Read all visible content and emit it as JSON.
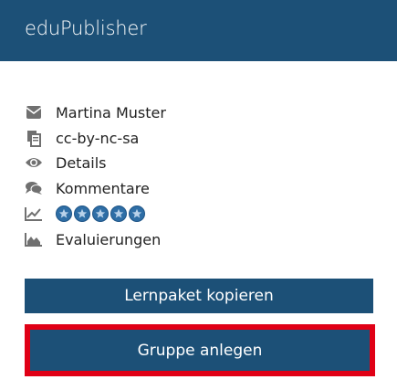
{
  "header": {
    "title": "eduPublisher"
  },
  "meta": {
    "author": "Martina Muster",
    "license": "cc-by-nc-sa",
    "details": "Details",
    "comments": "Kommentare",
    "rating": {
      "value": 5,
      "max": 5
    },
    "evaluations": "Evaluierungen"
  },
  "icons": {
    "author": "envelope-icon",
    "license": "copy-icon",
    "details": "eye-icon",
    "comments": "comments-icon",
    "rating": "line-chart-icon",
    "evaluations": "area-chart-icon"
  },
  "buttons": {
    "copy_package": "Lernpaket kopieren",
    "create_group": "Gruppe anlegen"
  },
  "colors": {
    "primary": "#1c5077",
    "highlight": "#e00016",
    "icon": "#707070",
    "star": "#2e6ea6"
  }
}
